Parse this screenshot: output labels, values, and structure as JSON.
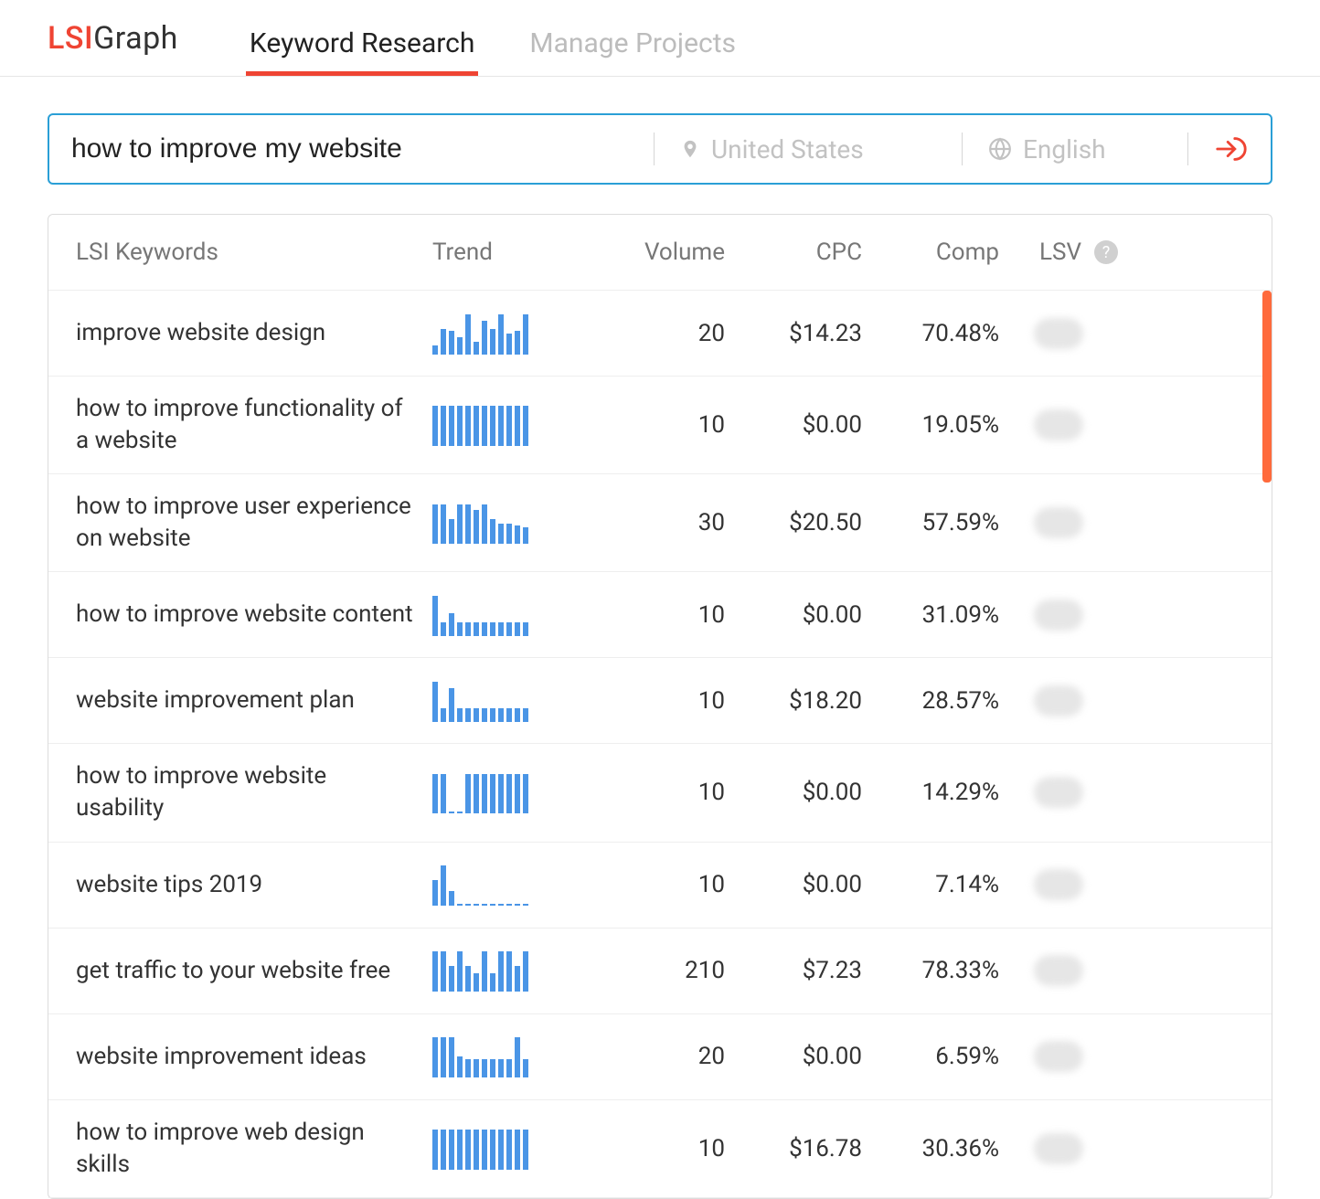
{
  "brand": {
    "lsi": "LSI",
    "graph": "Graph"
  },
  "nav": {
    "keyword_research": "Keyword Research",
    "manage_projects": "Manage Projects"
  },
  "search": {
    "query": "how to improve my website",
    "location": "United States",
    "language": "English"
  },
  "columns": {
    "keywords": "LSI Keywords",
    "trend": "Trend",
    "volume": "Volume",
    "cpc": "CPC",
    "comp": "Comp",
    "lsv": "LSV"
  },
  "rows": [
    {
      "keyword": "improve website design",
      "volume": "20",
      "cpc": "$14.23",
      "comp": "70.48%",
      "trend": [
        20,
        60,
        55,
        40,
        95,
        30,
        80,
        60,
        95,
        50,
        55,
        95
      ]
    },
    {
      "keyword": "how to improve functionality of a website",
      "volume": "10",
      "cpc": "$0.00",
      "comp": "19.05%",
      "trend": [
        95,
        95,
        95,
        95,
        95,
        95,
        95,
        95,
        95,
        95,
        95,
        95
      ]
    },
    {
      "keyword": "how to improve user experience on website",
      "volume": "30",
      "cpc": "$20.50",
      "comp": "57.59%",
      "trend": [
        95,
        95,
        60,
        95,
        95,
        80,
        95,
        60,
        48,
        48,
        44,
        40
      ]
    },
    {
      "keyword": "how to improve website content",
      "volume": "10",
      "cpc": "$0.00",
      "comp": "31.09%",
      "trend": [
        95,
        32,
        55,
        32,
        32,
        32,
        32,
        32,
        32,
        32,
        32,
        32
      ]
    },
    {
      "keyword": "website improvement plan",
      "volume": "10",
      "cpc": "$18.20",
      "comp": "28.57%",
      "trend": [
        95,
        32,
        80,
        32,
        32,
        32,
        32,
        32,
        32,
        32,
        32,
        32
      ]
    },
    {
      "keyword": "how to improve website usability",
      "volume": "10",
      "cpc": "$0.00",
      "comp": "14.29%",
      "trend": [
        95,
        95,
        0,
        0,
        95,
        95,
        95,
        95,
        95,
        95,
        95,
        95
      ]
    },
    {
      "keyword": "website tips 2019",
      "volume": "10",
      "cpc": "$0.00",
      "comp": "7.14%",
      "trend": [
        60,
        95,
        35,
        0,
        0,
        0,
        0,
        0,
        0,
        0,
        0,
        0
      ]
    },
    {
      "keyword": "get traffic to your website free",
      "volume": "210",
      "cpc": "$7.23",
      "comp": "78.33%",
      "trend": [
        95,
        95,
        60,
        95,
        60,
        44,
        95,
        44,
        95,
        95,
        60,
        95
      ]
    },
    {
      "keyword": "website improvement ideas",
      "volume": "20",
      "cpc": "$0.00",
      "comp": "6.59%",
      "trend": [
        95,
        95,
        95,
        50,
        44,
        44,
        44,
        44,
        44,
        44,
        95,
        44
      ]
    },
    {
      "keyword": "how to improve web design skills",
      "volume": "10",
      "cpc": "$16.78",
      "comp": "30.36%",
      "trend": [
        95,
        95,
        95,
        95,
        95,
        95,
        95,
        95,
        95,
        95,
        95,
        95
      ]
    }
  ],
  "chart_data": {
    "type": "bar",
    "title": "Keyword trend sparklines (relative monthly interest, 0–100)",
    "xlabel": "",
    "ylabel": "",
    "ylim": [
      0,
      100
    ],
    "series": [
      {
        "name": "improve website design",
        "values": [
          20,
          60,
          55,
          40,
          95,
          30,
          80,
          60,
          95,
          50,
          55,
          95
        ]
      },
      {
        "name": "how to improve functionality of a website",
        "values": [
          95,
          95,
          95,
          95,
          95,
          95,
          95,
          95,
          95,
          95,
          95,
          95
        ]
      },
      {
        "name": "how to improve user experience on website",
        "values": [
          95,
          95,
          60,
          95,
          95,
          80,
          95,
          60,
          48,
          48,
          44,
          40
        ]
      },
      {
        "name": "how to improve website content",
        "values": [
          95,
          32,
          55,
          32,
          32,
          32,
          32,
          32,
          32,
          32,
          32,
          32
        ]
      },
      {
        "name": "website improvement plan",
        "values": [
          95,
          32,
          80,
          32,
          32,
          32,
          32,
          32,
          32,
          32,
          32,
          32
        ]
      },
      {
        "name": "how to improve website usability",
        "values": [
          95,
          95,
          0,
          0,
          95,
          95,
          95,
          95,
          95,
          95,
          95,
          95
        ]
      },
      {
        "name": "website tips 2019",
        "values": [
          60,
          95,
          35,
          0,
          0,
          0,
          0,
          0,
          0,
          0,
          0,
          0
        ]
      },
      {
        "name": "get traffic to your website free",
        "values": [
          95,
          95,
          60,
          95,
          60,
          44,
          95,
          44,
          95,
          95,
          60,
          95
        ]
      },
      {
        "name": "website improvement ideas",
        "values": [
          95,
          95,
          95,
          50,
          44,
          44,
          44,
          44,
          44,
          44,
          95,
          44
        ]
      },
      {
        "name": "how to improve web design skills",
        "values": [
          95,
          95,
          95,
          95,
          95,
          95,
          95,
          95,
          95,
          95,
          95,
          95
        ]
      }
    ]
  }
}
